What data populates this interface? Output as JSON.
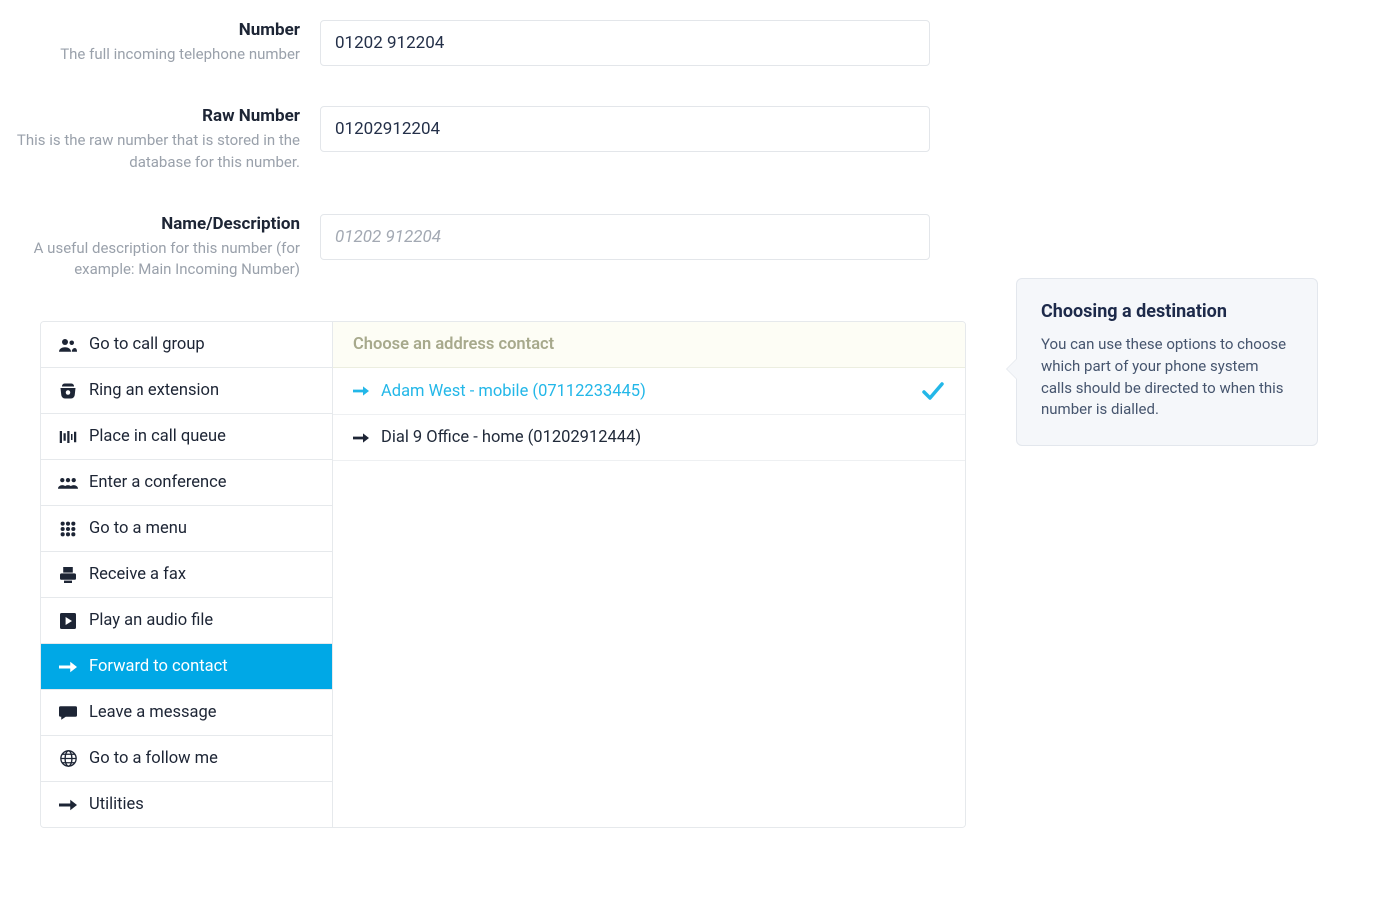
{
  "fields": {
    "number": {
      "label": "Number",
      "help": "The full incoming telephone number",
      "value": "01202 912204"
    },
    "raw_number": {
      "label": "Raw Number",
      "help": "This is the raw number that is stored in the database for this number.",
      "value": "01202912204"
    },
    "name_desc": {
      "label": "Name/Description",
      "help": "A useful description for this number (for example: Main Incoming Number)",
      "value": "",
      "placeholder": "01202 912204"
    }
  },
  "sidebar": {
    "items": [
      {
        "label": "Go to call group",
        "icon": "group-icon"
      },
      {
        "label": "Ring an extension",
        "icon": "phone-icon"
      },
      {
        "label": "Place in call queue",
        "icon": "queue-icon"
      },
      {
        "label": "Enter a conference",
        "icon": "conference-icon"
      },
      {
        "label": "Go to a menu",
        "icon": "menu-icon"
      },
      {
        "label": "Receive a fax",
        "icon": "fax-icon"
      },
      {
        "label": "Play an audio file",
        "icon": "play-icon"
      },
      {
        "label": "Forward to contact",
        "icon": "forward-icon",
        "active": true
      },
      {
        "label": "Leave a message",
        "icon": "message-icon"
      },
      {
        "label": "Go to a follow me",
        "icon": "globe-icon"
      },
      {
        "label": "Utilities",
        "icon": "arrow-icon"
      }
    ]
  },
  "contacts": {
    "header": "Choose an address contact",
    "items": [
      {
        "label": "Adam West - mobile (07112233445)",
        "selected": true
      },
      {
        "label": "Dial 9 Office - home (01202912444)",
        "selected": false
      }
    ]
  },
  "help": {
    "title": "Choosing a destination",
    "body": "You can use these options to choose which part of your phone system calls should be directed to when this number is dialled."
  },
  "colors": {
    "accent": "#00a8e6",
    "selected_text": "#23b7e8"
  }
}
